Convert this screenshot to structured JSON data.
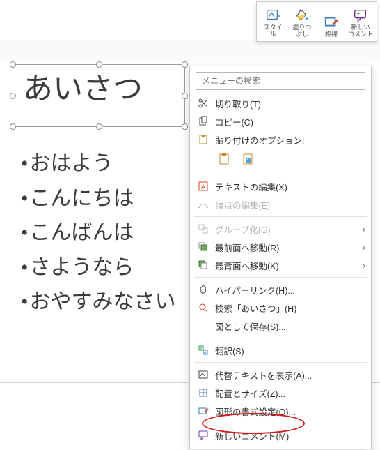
{
  "mini_toolbar": {
    "style": "スタイ\nル",
    "fill": "塗りつ\nぶし",
    "outline": "枠線",
    "new_comment": "新しい\nコメント"
  },
  "search": {
    "placeholder": "メニューの検索"
  },
  "textbox": {
    "title": "あいさつ"
  },
  "bullets": [
    "おはよう",
    "こんにちは",
    "こんばんは",
    "さようなら",
    "おやすみなさい"
  ],
  "menu": {
    "cut": "切り取り(T)",
    "copy": "コピー(C)",
    "paste_label": "貼り付けのオプション:",
    "edit_text": "テキストの編集(X)",
    "edit_points": "頂点の編集(E)",
    "group": "グループ化(G)",
    "bring_front": "最前面へ移動(R)",
    "send_back": "最背面へ移動(K)",
    "hyperlink": "ハイパーリンク(H)...",
    "search_q": "検索「あいさつ」(H)",
    "save_as_pic": "図として保存(S)...",
    "translate": "翻訳(S)",
    "alt_text": "代替テキストを表示(A)...",
    "size_pos": "配置とサイズ(Z)...",
    "format_shape": "図形の書式設定(O)...",
    "new_comment": "新しいコメント(M)"
  }
}
